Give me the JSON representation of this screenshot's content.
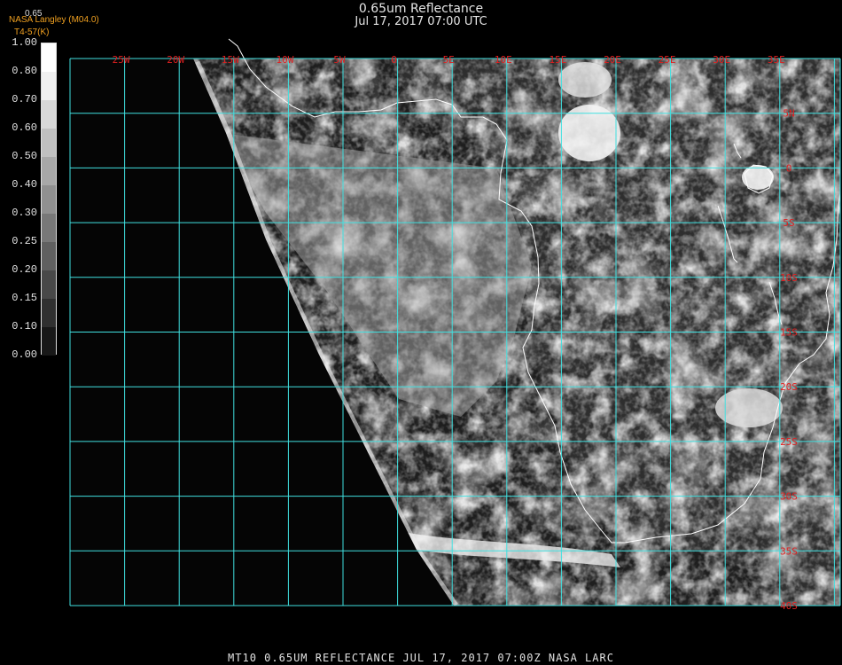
{
  "header": {
    "title": "0.65um Reflectance",
    "datetime": "Jul 17, 2017 07:00 UTC",
    "credit": "NASA Langley (M04.0)",
    "subcredit": "T4-57(K)",
    "corner_label": "0.65"
  },
  "colorbar": {
    "labels": [
      "1.00",
      "0.80",
      "0.70",
      "0.60",
      "0.50",
      "0.40",
      "0.30",
      "0.25",
      "0.20",
      "0.15",
      "0.10",
      "0.00"
    ],
    "fills": [
      "#ffffff",
      "#f0f0f0",
      "#d8d8d8",
      "#c0c0c0",
      "#a8a8a8",
      "#909090",
      "#787878",
      "#606060",
      "#484848",
      "#303030",
      "#181818"
    ]
  },
  "map": {
    "longitude_labels": [
      "25W",
      "20W",
      "15W",
      "10W",
      "5W",
      "0",
      "5E",
      "10E",
      "15E",
      "20E",
      "25E",
      "30E",
      "35E"
    ],
    "latitude_labels": [
      "5N",
      "0",
      "5S",
      "10S",
      "15S",
      "20S",
      "25S",
      "30S",
      "35S",
      "40S"
    ],
    "grid_color": "#40e0e0",
    "label_color": "#e02020",
    "coast_color": "#ffffff"
  },
  "footer": {
    "text": "MT10  0.65UM REFLECTANCE   JUL 17, 2017 07:00Z   NASA LARC"
  }
}
